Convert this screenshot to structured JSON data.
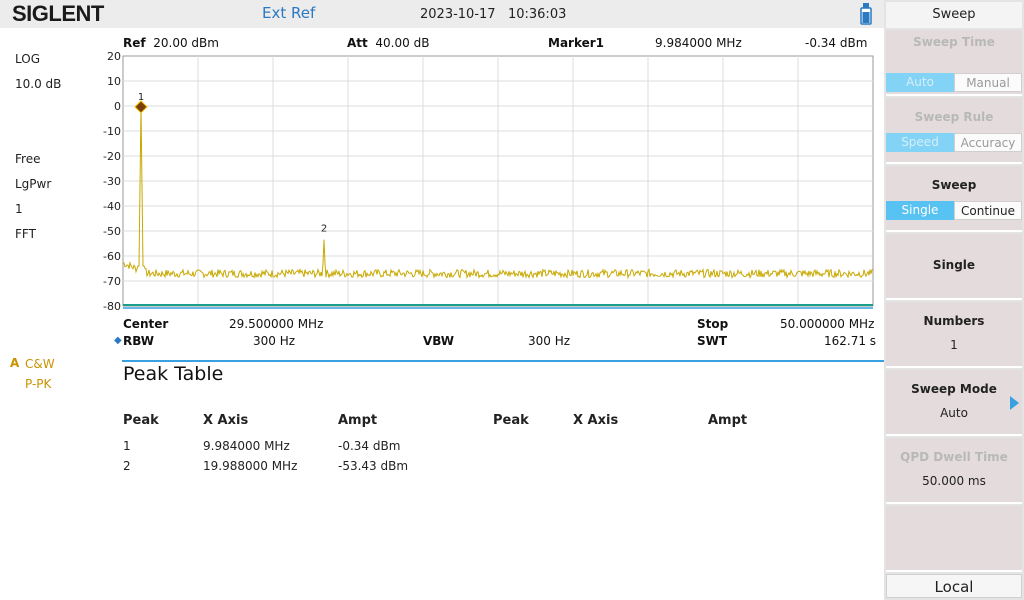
{
  "header": {
    "brand": "SIGLENT",
    "ext_ref": "Ext Ref",
    "date": "2023-10-17",
    "time": "10:36:03",
    "usb_icon": "usb-drive-icon"
  },
  "left_info": {
    "scale_type": "LOG",
    "scale_div": "10.0 dB",
    "trig": "Free",
    "detector": "LgPwr",
    "avg": "1",
    "mode": "FFT",
    "trace_letter": "A",
    "trace_mode": "C&W",
    "trace_det": "P-PK"
  },
  "meas_header": {
    "ref_label": "Ref",
    "ref_value": "20.00 dBm",
    "att_label": "Att",
    "att_value": "40.00 dB",
    "marker_label": "Marker1",
    "marker_freq": "9.984000 MHz",
    "marker_ampl": "-0.34 dBm"
  },
  "chart_data": {
    "type": "line",
    "ylim": [
      -80,
      20
    ],
    "y_ticks": [
      "20",
      "10",
      "0",
      "-10",
      "-20",
      "-30",
      "-40",
      "-50",
      "-60",
      "-70",
      "-80"
    ],
    "xlim": [
      9.0,
      50.0
    ],
    "x_unit": "MHz",
    "grid": true,
    "noise_floor_dbm": -67,
    "series": [
      {
        "color": "#c8a800",
        "x": [
          9.984,
          19.988
        ],
        "values": [
          -0.34,
          -53.43
        ]
      }
    ],
    "markers": [
      {
        "label": "1",
        "x": 9.984,
        "y": -0.34
      },
      {
        "label": "2",
        "x": 19.988,
        "y": -53.43
      }
    ]
  },
  "freq_info": {
    "center_label": "Center",
    "center_value": "29.500000 MHz",
    "stop_label": "Stop",
    "stop_value": "50.000000 MHz",
    "rbw_label": "RBW",
    "rbw_value": "300 Hz",
    "vbw_label": "VBW",
    "vbw_value": "300 Hz",
    "swt_label": "SWT",
    "swt_value": "162.71 s"
  },
  "peak_table": {
    "title": "Peak Table",
    "columns": [
      "Peak",
      "X Axis",
      "Ampt",
      "Peak",
      "X Axis",
      "Ampt"
    ],
    "rows": [
      {
        "peak": "1",
        "x": "9.984000 MHz",
        "ampt": "-0.34 dBm"
      },
      {
        "peak": "2",
        "x": "19.988000 MHz",
        "ampt": "-53.43 dBm"
      }
    ]
  },
  "softkeys": {
    "menu_title": "Sweep",
    "sweep_time": {
      "label": "Sweep Time",
      "opt_a": "Auto",
      "opt_b": "Manual"
    },
    "sweep_rule": {
      "label": "Sweep Rule",
      "opt_a": "Speed",
      "opt_b": "Accuracy"
    },
    "sweep": {
      "label": "Sweep",
      "opt_a": "Single",
      "opt_b": "Continue"
    },
    "single": {
      "label": "Single"
    },
    "numbers": {
      "label": "Numbers",
      "value": "1"
    },
    "sweep_mode": {
      "label": "Sweep Mode",
      "value": "Auto"
    },
    "qpd_dwell": {
      "label": "QPD Dwell Time",
      "value": "50.000 ms"
    },
    "local": "Local"
  },
  "colors": {
    "trace": "#c8a800",
    "accent": "#3aa0e0",
    "marker": "#7a3e0a"
  }
}
